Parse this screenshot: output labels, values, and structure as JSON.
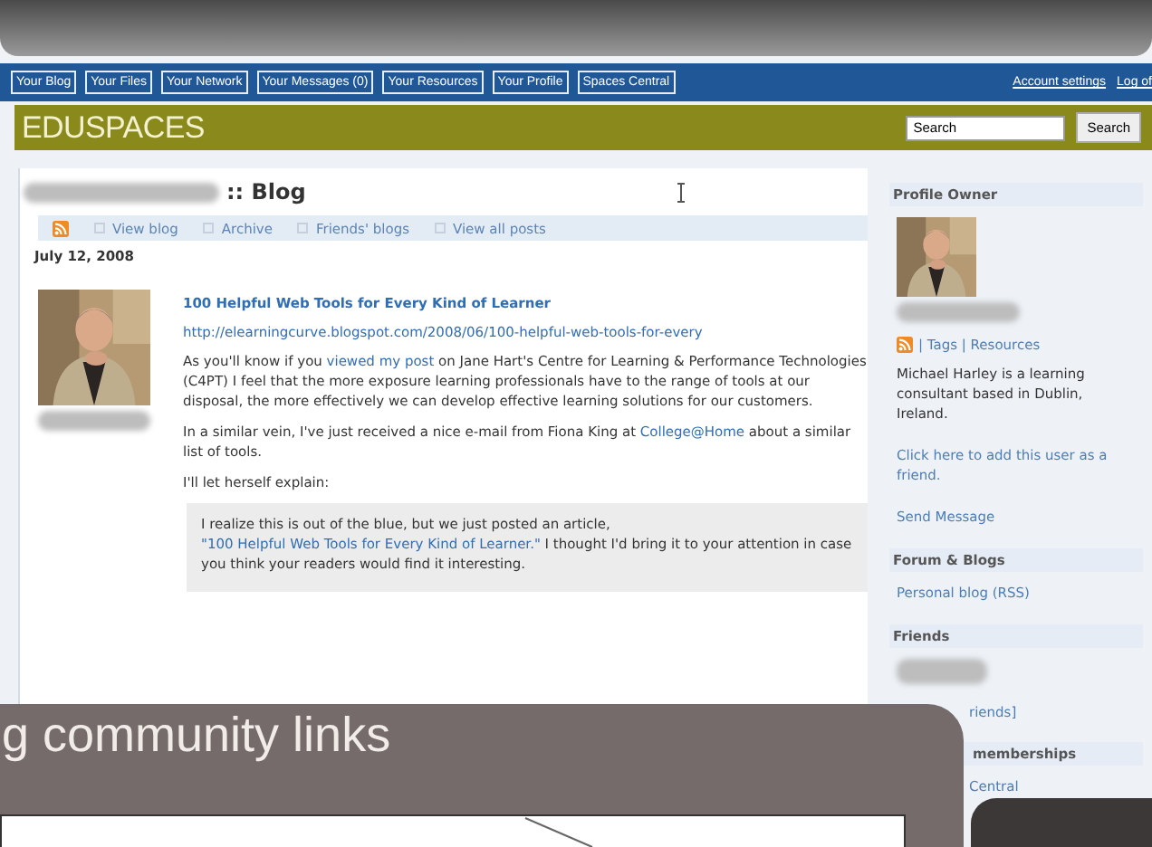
{
  "nav": {
    "items": [
      {
        "label": "Your Blog"
      },
      {
        "label": "Your Files"
      },
      {
        "label": "Your Network"
      },
      {
        "label": "Your Messages (0)"
      },
      {
        "label": "Your Resources"
      },
      {
        "label": "Your Profile"
      },
      {
        "label": "Spaces Central"
      }
    ],
    "account_links": [
      "Account settings",
      "Log of"
    ]
  },
  "header": {
    "logo": "EDUSPACES",
    "search_value": "Search",
    "search_button": "Search"
  },
  "blog": {
    "title": ":: Blog",
    "tabs": [
      "View blog",
      "Archive",
      "Friends' blogs",
      "View all posts"
    ],
    "date": "July 12, 2008",
    "post": {
      "title": "100 Helpful Web Tools for Every Kind of Learner",
      "url": "http://elearningcurve.blogspot.com/2008/06/100-helpful-web-tools-for-every",
      "paragraphs": [
        [
          {
            "kind": "text",
            "text": "As you'll know if you "
          },
          {
            "kind": "link",
            "text": "viewed my post"
          },
          {
            "kind": "text",
            "text": " on Jane Hart's Centre for Learning & Performance Technologies (C4PT) I feel that the more exposure learning professionals have to the range of tools at our disposal, the more effectively we can develop effective learning solutions for our customers."
          }
        ],
        [
          {
            "kind": "text",
            "text": "In a similar vein, I've just received a nice e-mail from Fiona King at "
          },
          {
            "kind": "link",
            "text": "College@Home"
          },
          {
            "kind": "text",
            "text": " about a similar list of tools."
          }
        ],
        [
          {
            "kind": "text",
            "text": "I'll let herself explain:"
          }
        ]
      ],
      "quote": [
        {
          "kind": "text",
          "text": "I realize this is out of the blue, but we just posted an article, "
        },
        {
          "kind": "link",
          "text": "\"100 Helpful Web Tools for Every Kind of Learner.\""
        },
        {
          "kind": "text",
          "text": " I thought I'd bring it to your attention in case you think your readers would find it interesting."
        }
      ]
    }
  },
  "sidebar": {
    "sections": [
      {
        "heading": "Profile Owner",
        "kind": "profile",
        "links": [
          "| Tags | Resources"
        ],
        "bio": "Michael Harley is a learning consultant based in Dublin, Ireland.",
        "add_friend": "Click here to add this user as a friend.",
        "send": "Send Message"
      },
      {
        "heading": "Forum & Blogs",
        "kind": "links",
        "links": [
          "Personal blog (RSS)"
        ]
      },
      {
        "heading": "Friends",
        "kind": "friends",
        "links": [
          "riends]"
        ]
      },
      {
        "heading": "memberships",
        "kind": "covered",
        "links": [
          "Central"
        ]
      }
    ]
  },
  "overlay": {
    "title": "g community links"
  }
}
